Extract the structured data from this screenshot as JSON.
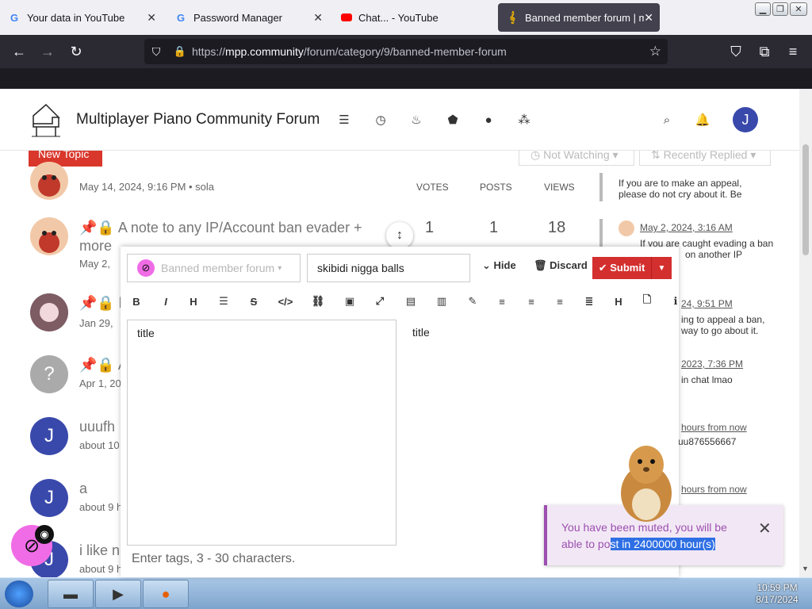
{
  "browser": {
    "tabs": [
      {
        "title": "Your data in YouTube",
        "favicon": "google-icon"
      },
      {
        "title": "Password Manager",
        "favicon": "google-icon"
      },
      {
        "title": "Chat... - YouTube",
        "favicon": "youtube-icon"
      },
      {
        "title": "Banned member forum | mp",
        "favicon": "clef-icon",
        "active": true
      }
    ],
    "url": {
      "scheme": "https://",
      "host": "mpp.community",
      "path": "/forum/category/9/banned-member-forum"
    }
  },
  "forum": {
    "name": "Multiplayer Piano Community Forum",
    "new_topic_label": "New Topic",
    "watch_label": "Not Watching",
    "sort_label": "Recently Replied",
    "columns": {
      "votes": "VOTES",
      "posts": "POSTS",
      "views": "VIEWS"
    },
    "topics": [
      {
        "meta": "May 14, 2024, 9:16 PM • sola"
      },
      {
        "title": "A note to any IP/Account ban evader + more",
        "meta": "May 2,",
        "votes": "1",
        "posts": "1",
        "views": "18"
      },
      {
        "title": "b",
        "meta": "Jan 29,"
      },
      {
        "title": "A",
        "meta": "Apr 1, 20",
        "avatar": "?"
      },
      {
        "title": "uuufh",
        "meta": "about 10",
        "avatar": "J"
      },
      {
        "title": "a",
        "meta": "about 9 h",
        "avatar": "J"
      },
      {
        "title": "i like n",
        "meta": "about 9 h",
        "avatar": "J"
      }
    ],
    "teasers": [
      {
        "text1": "If you are to make an appeal,",
        "text2": "please do not cry about it. Be"
      },
      {
        "date": "May 2, 2024, 3:16 AM",
        "text1": "If you are caught evading a ban",
        "text2": "on another IP"
      },
      {
        "date": "24, 9:51 PM",
        "text1": "ing to appeal a ban,",
        "text2": "way to go about it."
      },
      {
        "date": "2023, 7:36 PM",
        "text1": "in chat lmao"
      },
      {
        "date": "hours from now",
        "text1": "uu876556667"
      },
      {
        "date": "hours from now"
      }
    ]
  },
  "composer": {
    "category": "Banned member forum",
    "title_value": "skibidi nigga balls",
    "hide_label": "Hide",
    "discard_label": "Discard",
    "submit_label": "Submit",
    "editor_text": "title",
    "preview_text": "title",
    "tags_placeholder": "Enter tags, 3 - 30 characters."
  },
  "toast": {
    "text_before": "You have been muted, you will be able to po",
    "text_selected": "st in 2400000 hour(s)"
  },
  "taskbar": {
    "time": "10:59 PM",
    "date": "8/17/2024"
  },
  "colors": {
    "submit": "#d32f2f",
    "toast_accent": "#9c4fb0",
    "avatar": "#3949ab",
    "pin": "#9c5fa6"
  }
}
